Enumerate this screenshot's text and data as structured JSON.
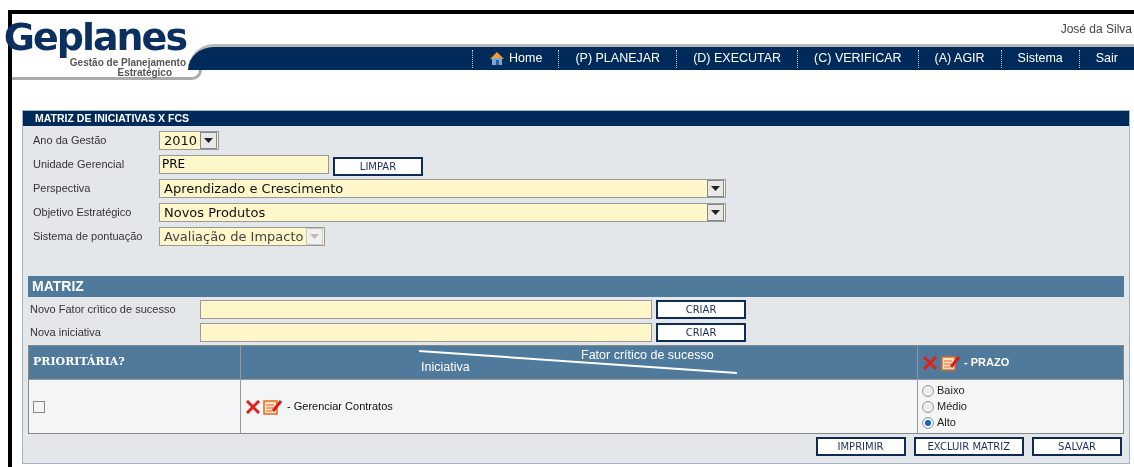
{
  "logo": {
    "name": "Geplanes",
    "tagline": "Gestão de Planejamento",
    "tagline_2": "Estratégico"
  },
  "user": "José da Silva",
  "nav": [
    {
      "label": "Home",
      "kind": "home"
    },
    {
      "label": "(P) PLANEJAR",
      "kind": "text"
    },
    {
      "label": "(D) EXECUTAR",
      "kind": "text"
    },
    {
      "label": "(C) VERIFICAR",
      "kind": "text"
    },
    {
      "label": "(A) AGIR",
      "kind": "text"
    },
    {
      "label": "Sistema",
      "kind": "text"
    },
    {
      "label": "Sair",
      "kind": "text"
    }
  ],
  "filter": {
    "title": "MATRIZ DE INICIATIVAS X FCS",
    "fields": [
      {
        "label": "Ano da Gestão",
        "kind": "compact_select",
        "value": "2010",
        "disabled": false
      },
      {
        "label": "Unidade Gerencial",
        "kind": "text",
        "value": "PRE",
        "button": "LIMPAR"
      },
      {
        "label": "Perspectiva",
        "kind": "select",
        "value": "Aprendizado e Crescimento",
        "disabled": false
      },
      {
        "label": "Objetivo Estratégico",
        "kind": "select",
        "value": "Novos Produtos",
        "disabled": false
      },
      {
        "label": "Sistema de pontuação",
        "kind": "compact_select",
        "value": "Avaliação de Impacto",
        "disabled": true
      }
    ]
  },
  "matriz": {
    "title": "MATRIZ",
    "inputs": [
      {
        "label": "Novo Fator crìtico de sucesso",
        "button": "CRIAR"
      },
      {
        "label": "Nova iniciativa",
        "button": "CRIAR"
      }
    ],
    "table": {
      "col_priority": "PRIORITÁRIA?",
      "col_initiative": "Iniciativa",
      "col_factor": "Fator crítico de sucesso",
      "col_deadline": "- PRAZO",
      "rows": [
        {
          "checked": false,
          "initiative": "- Gerenciar Contratos",
          "options": [
            {
              "label": "Baixo",
              "selected": false
            },
            {
              "label": "Médio",
              "selected": false
            },
            {
              "label": "Alto",
              "selected": true
            }
          ]
        }
      ]
    },
    "buttons": [
      "IMPRIMIR",
      "EXCLUIR MATRIZ",
      "SALVAR"
    ]
  }
}
